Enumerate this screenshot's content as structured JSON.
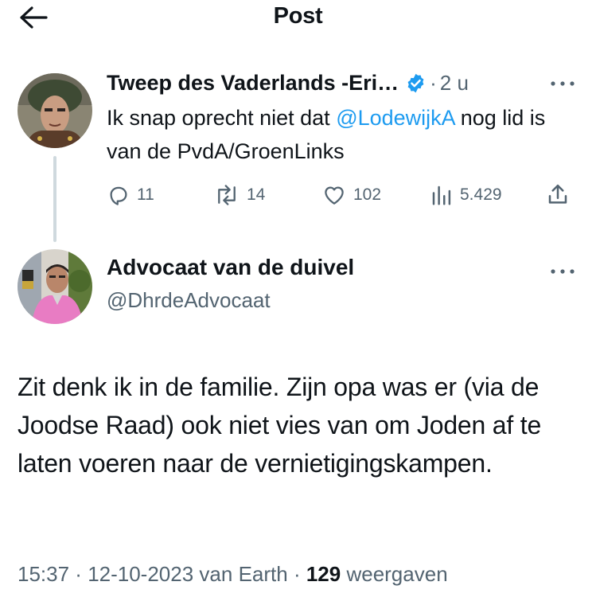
{
  "header": {
    "title": "Post",
    "back_icon": "arrow-left-icon"
  },
  "parent_post": {
    "author_name": "Tweep des Vaderlands -Eri…",
    "verified": true,
    "time_separator": "·",
    "time": "2 u",
    "text_before_mention": "Ik snap oprecht niet dat ",
    "mention": "@LodewijkA",
    "text_after_mention": " nog lid is van de PvdA/GroenLinks",
    "reply_count": "11",
    "repost_count": "14",
    "like_count": "102",
    "view_count": "5.429"
  },
  "reply_post": {
    "author_name": "Advocaat van de duivel",
    "handle": "@DhrdeAdvocaat",
    "text": "Zit denk ik in de familie. Zijn opa was er (via de Joodse Raad) ook niet vies van om Joden af te laten voeren naar de vernietigingskampen.",
    "time": "15:37",
    "date": "12-10-2023",
    "source": "van Earth",
    "views_count": "129",
    "views_label": "weergaven"
  },
  "colors": {
    "accent": "#1d9bf0",
    "secondary_text": "#536471",
    "thread_line": "#cfd9de"
  }
}
